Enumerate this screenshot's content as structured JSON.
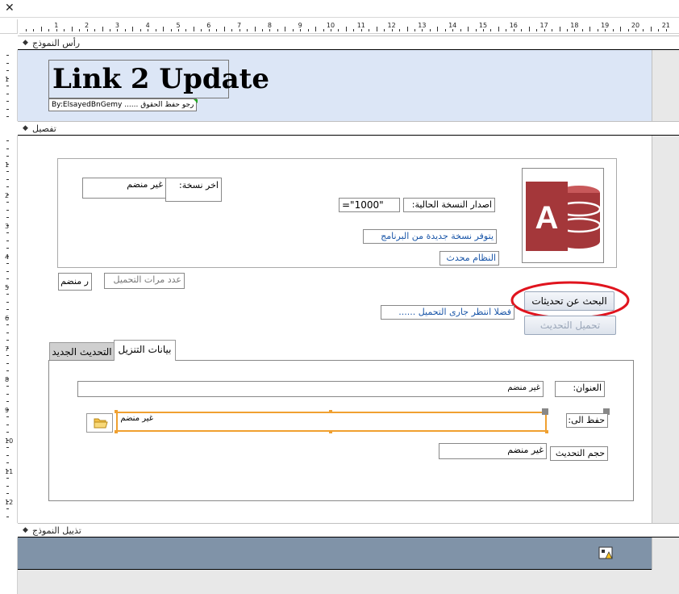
{
  "window": {
    "close_glyph": "✕"
  },
  "ruler": {
    "h_numbers": [
      "1",
      "2",
      "3",
      "4",
      "5",
      "6",
      "7",
      "8",
      "9",
      "10",
      "11",
      "12",
      "13",
      "14",
      "15",
      "16",
      "17",
      "18",
      "19",
      "20",
      "21"
    ],
    "v_header_numbers": [
      "1"
    ],
    "v_detail_numbers": [
      "1",
      "2",
      "3",
      "4",
      "5",
      "6",
      "7",
      "8",
      "9",
      "10",
      "11",
      "12"
    ]
  },
  "sections": {
    "form_header": "رأس النموذج",
    "detail": "تفصيل",
    "form_footer": "تذييل النموذج"
  },
  "header": {
    "title": "Link 2 Update",
    "byline": "By:ElsayedBnGemy ...... رجو حفظ الحقوق"
  },
  "detail": {
    "latest_version_label": "اخر نسخة:",
    "latest_version_value": "غير منضم",
    "current_version_label": "اصدار النسخة الحالية:",
    "current_version_value": "=\"1000\"",
    "new_version_msg": "يتوفر نسخة جديدة من البرنامج",
    "system_updated_msg": "النظام محدث",
    "download_count_label": "عدد مرات التحميل",
    "download_count_value": "ر منضم",
    "check_updates_button": "البحث عن تحديثات",
    "download_update_button": "تحميل التحديث",
    "loading_msg": "فضلا انتظر جارى التحميل ......",
    "tabs": [
      {
        "label": "بيانات التنزيل",
        "active": true
      },
      {
        "label": "التحديث الجديد",
        "active": false
      }
    ],
    "address_label": "العنوان:",
    "address_value": "غير منضم",
    "save_to_label": "حفظ الى:",
    "save_to_value": "غير منضم",
    "update_size_label": "حجم التحديث",
    "update_size_value": "غير منضم"
  },
  "colors": {
    "header_bg": "#dce6f6",
    "footer_bg": "#8093a8",
    "access_red": "#a4373a",
    "selection_orange": "#f0a030",
    "annotation_red": "#e0141e",
    "link_blue": "#1a56a8"
  },
  "icons": {
    "access_logo": "access-logo-icon",
    "folder": "folder-icon",
    "footer_control": "control-icon"
  }
}
